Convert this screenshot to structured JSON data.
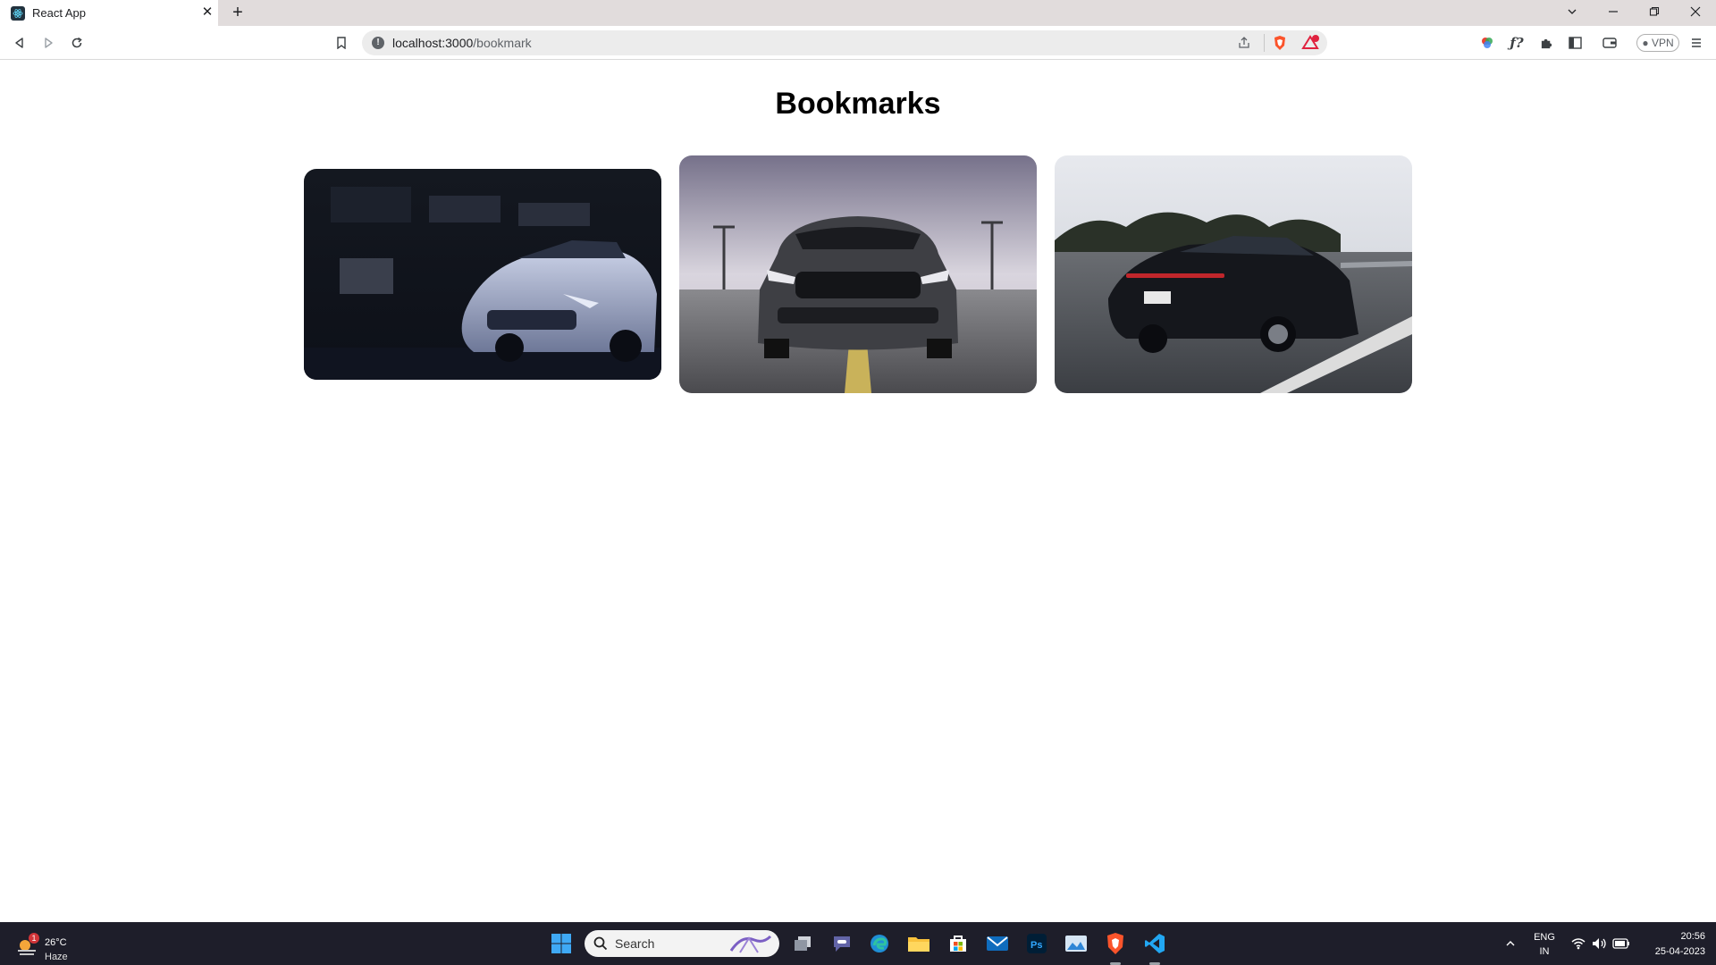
{
  "browser": {
    "tab": {
      "title": "React App"
    },
    "url": {
      "host": "localhost:3000",
      "path": "/bookmark"
    },
    "vpn_label": "VPN",
    "shield_badge": "0"
  },
  "page": {
    "title": "Bookmarks",
    "bookmarks": [
      {
        "subject": "white sports car in dark garage",
        "accent": "#9aa4c4"
      },
      {
        "subject": "grey muscle car front view on tarmac",
        "accent": "#4a4a50"
      },
      {
        "subject": "black sedan driving on highway",
        "accent": "#1c1f24"
      }
    ]
  },
  "taskbar": {
    "weather": {
      "temp": "26°C",
      "desc": "Haze",
      "badge": "1"
    },
    "search_placeholder": "Search",
    "language": {
      "lang": "ENG",
      "region": "IN"
    },
    "clock": {
      "time": "20:56",
      "date": "25-04-2023"
    }
  },
  "colors": {
    "tabbar_bg": "#e1dcdc",
    "taskbar_bg": "#1e1e2a",
    "brave_orange": "#fb542b"
  }
}
